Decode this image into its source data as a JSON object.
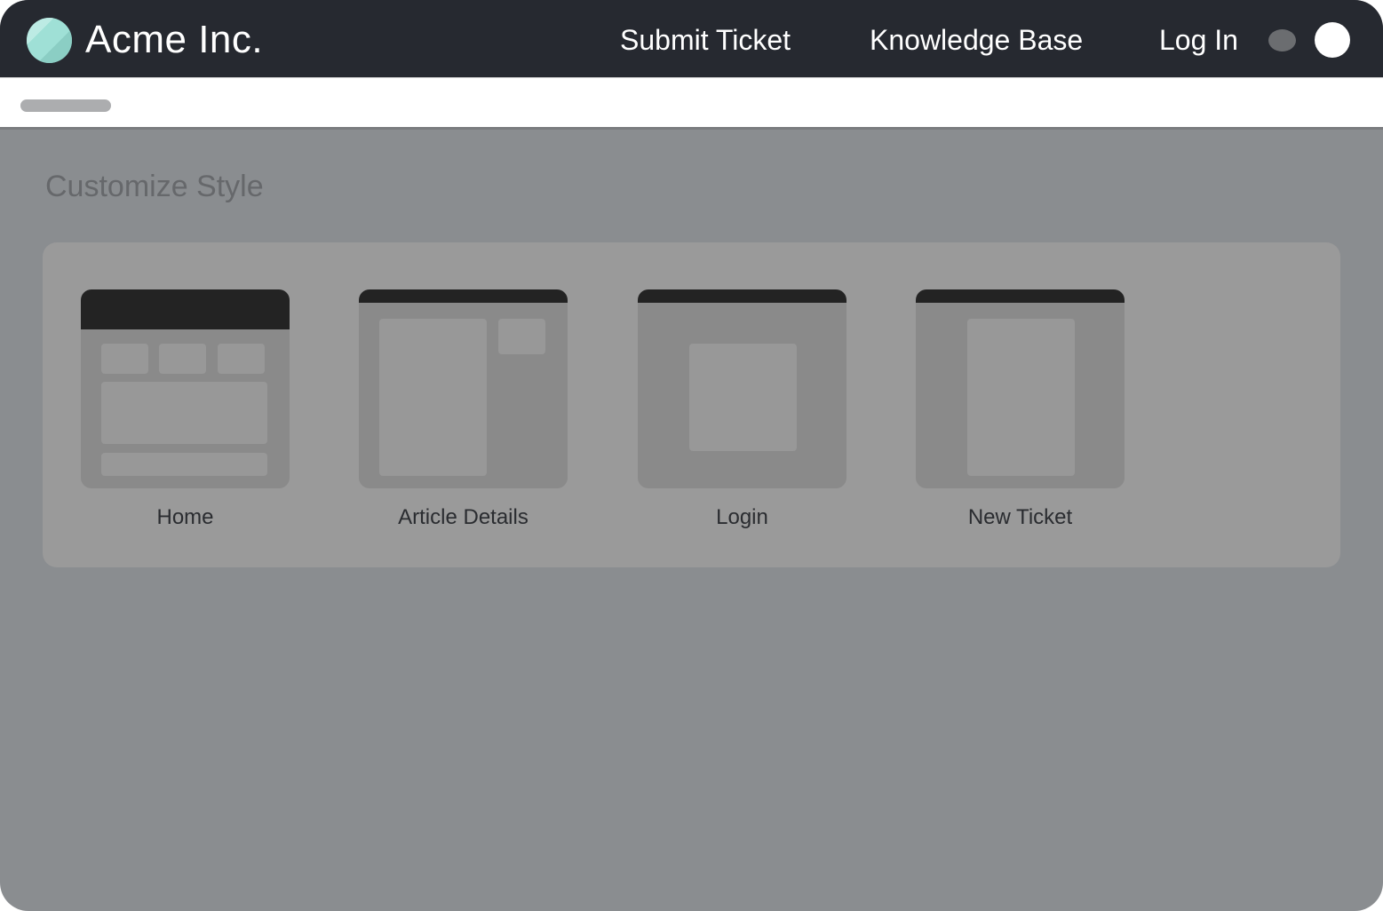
{
  "header": {
    "brand": "Acme Inc.",
    "logo_icon": "brand-logo-circle",
    "nav": [
      {
        "label": "Submit Ticket"
      },
      {
        "label": "Knowledge Base"
      },
      {
        "label": "Log In"
      }
    ],
    "status_indicator_icon": "toggle-dot",
    "avatar_icon": "user-avatar-circle"
  },
  "subheader": {
    "breadcrumb_placeholder": "loading-placeholder"
  },
  "main": {
    "title": "Customize Style",
    "templates": [
      {
        "label": "Home",
        "preview": "home-layout-preview"
      },
      {
        "label": "Article Details",
        "preview": "article-details-layout-preview"
      },
      {
        "label": "Login",
        "preview": "login-layout-preview"
      },
      {
        "label": "New Ticket",
        "preview": "new-ticket-layout-preview"
      }
    ]
  },
  "colors": {
    "topbar": "#262930",
    "logo_accent": "#9fe0d6",
    "overlay": "#8a8d90",
    "panel": "#9a9a9a",
    "preview_header": "#232323"
  }
}
